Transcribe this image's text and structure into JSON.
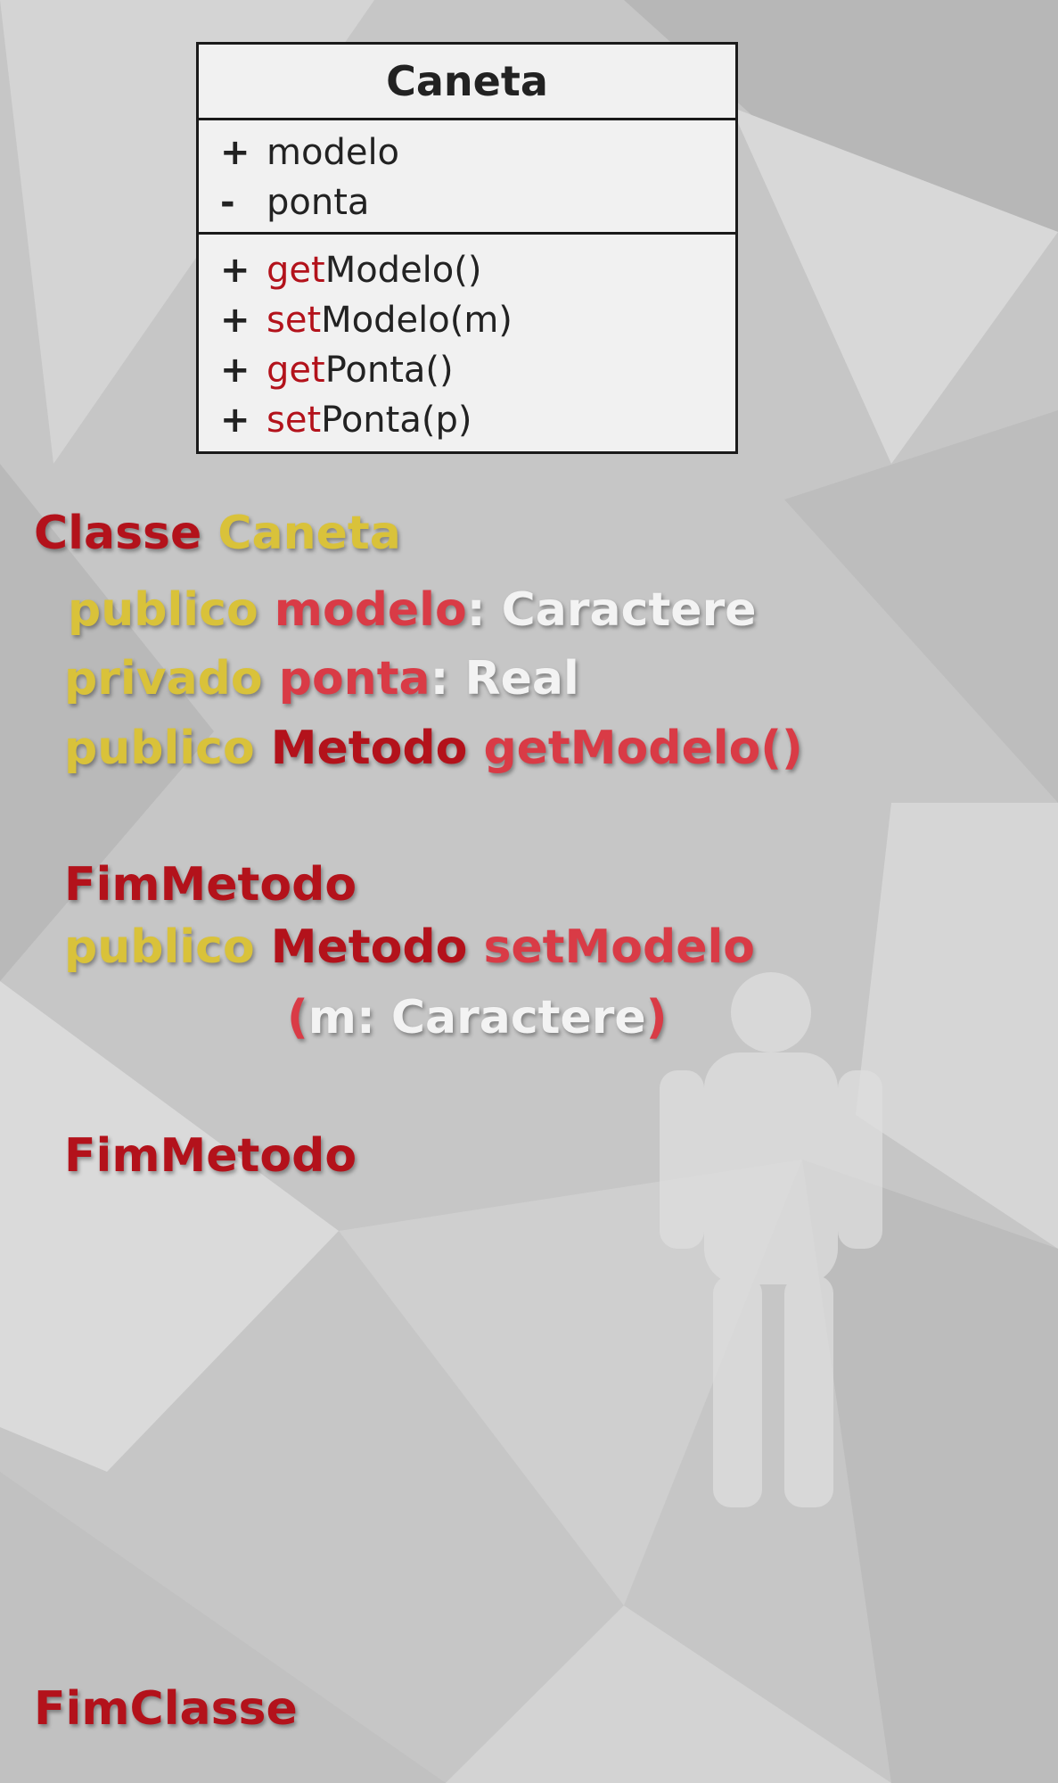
{
  "uml": {
    "class_name": "Caneta",
    "attributes": [
      {
        "visibility": "+",
        "name": "modelo"
      },
      {
        "visibility": "-",
        "name": "ponta"
      }
    ],
    "methods": [
      {
        "visibility": "+",
        "prefix": "get",
        "rest": "Modelo()"
      },
      {
        "visibility": "+",
        "prefix": "set",
        "rest": "Modelo(m)"
      },
      {
        "visibility": "+",
        "prefix": "get",
        "rest": "Ponta()"
      },
      {
        "visibility": "+",
        "prefix": "set",
        "rest": "Ponta(p)"
      }
    ]
  },
  "code": {
    "class_kw": "Classe",
    "class_name": "Caneta",
    "line1": {
      "vis": "publico",
      "name": "modelo",
      "type": ": Caractere"
    },
    "line2": {
      "vis": "privado",
      "name": "ponta",
      "type": ": Real"
    },
    "method1": {
      "vis": "publico",
      "kw": "Metodo",
      "name": "getModelo()"
    },
    "end1": "FimMetodo",
    "method2": {
      "vis": "publico",
      "kw": "Metodo",
      "name": "setModelo"
    },
    "method2_params": {
      "open": "(",
      "param": "m: Caractere",
      "close": ")"
    },
    "end2": "FimMetodo",
    "end_class": "FimClasse"
  },
  "colors": {
    "red": "#b3121b",
    "yellow": "#d9c23a",
    "pink": "#d93b46",
    "white": "#f3f3f3"
  }
}
